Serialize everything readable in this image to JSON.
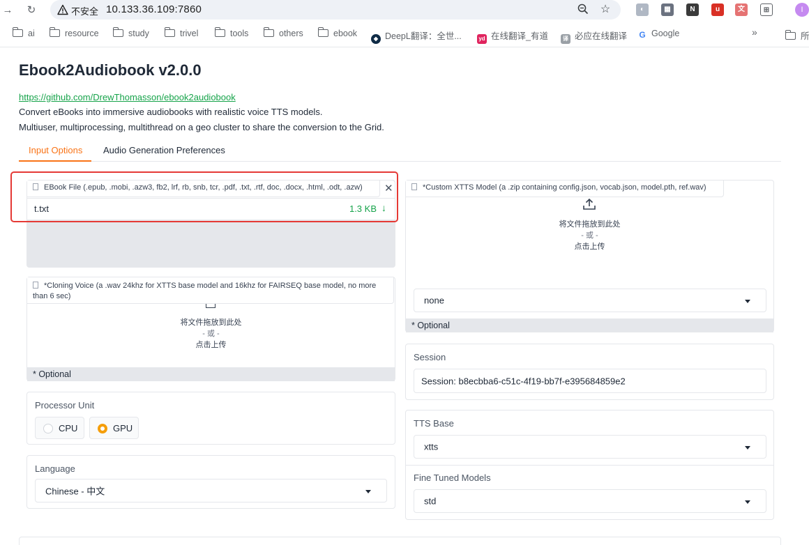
{
  "browser": {
    "insecure_label": "不安全",
    "url": "10.133.36.109:7860",
    "avatar_letter": "I",
    "bookmarks": [
      {
        "label": "ai",
        "type": "folder"
      },
      {
        "label": "resource",
        "type": "folder"
      },
      {
        "label": "study",
        "type": "folder"
      },
      {
        "label": "trivel",
        "type": "folder"
      },
      {
        "label": "tools",
        "type": "folder"
      },
      {
        "label": "others",
        "type": "folder"
      },
      {
        "label": "ebook",
        "type": "folder"
      },
      {
        "label": "DeepL翻译：全世...",
        "type": "site"
      },
      {
        "label": "在线翻译_有道",
        "type": "site"
      },
      {
        "label": "必应在线翻译",
        "type": "site"
      },
      {
        "label": "Google",
        "type": "site"
      }
    ],
    "bookmarks_overflow": "»",
    "all_bookmarks_label": "所"
  },
  "page": {
    "title": "Ebook2Audiobook v2.0.0",
    "link": "https://github.com/DrewThomasson/ebook2audiobook",
    "desc1": "Convert eBooks into immersive audiobooks with realistic voice TTS models.",
    "desc2": "Multiuser, multiprocessing, multithread on a geo cluster to share the conversion to the Grid."
  },
  "tabs": [
    "Input Options",
    "Audio Generation Preferences"
  ],
  "ebook_file": {
    "label": "EBook File (.epub, .mobi, .azw3, fb2, lrf, rb, snb, tcr, .pdf, .txt, .rtf, doc, .docx, .html, .odt, .azw)",
    "file_name": "t.txt",
    "file_size": "1.3 KB"
  },
  "custom_model": {
    "label": "*Custom XTTS Model (a .zip containing config.json, vocab.json, model.pth, ref.wav)",
    "drop_text": "将文件拖放到此处",
    "or_text": "- 或 -",
    "click_text": "点击上传",
    "select_value": "none",
    "optional": "* Optional"
  },
  "cloning_voice": {
    "label_line1": "*Cloning Voice (a .wav 24khz for XTTS base model and 16khz for FAIRSEQ base model, no more",
    "label_line2": "than 6 sec)",
    "drop_text": "将文件拖放到此处",
    "or_text": "- 或 -",
    "click_text": "点击上传",
    "optional": "* Optional"
  },
  "processor": {
    "label": "Processor Unit",
    "options": [
      "CPU",
      "GPU"
    ],
    "selected": "GPU"
  },
  "language": {
    "label": "Language",
    "value": "Chinese - 中文"
  },
  "session": {
    "label": "Session",
    "value": "Session: b8ecbba6-c51c-4f19-bb7f-e395684859e2"
  },
  "tts_base": {
    "label": "TTS Base",
    "value": "xtts"
  },
  "fine_tuned": {
    "label": "Fine Tuned Models",
    "value": "std"
  },
  "colors": {
    "accent": "#f97316",
    "link": "#16a34a",
    "highlight": "#e53935",
    "radio_on": "#f59e0b"
  }
}
